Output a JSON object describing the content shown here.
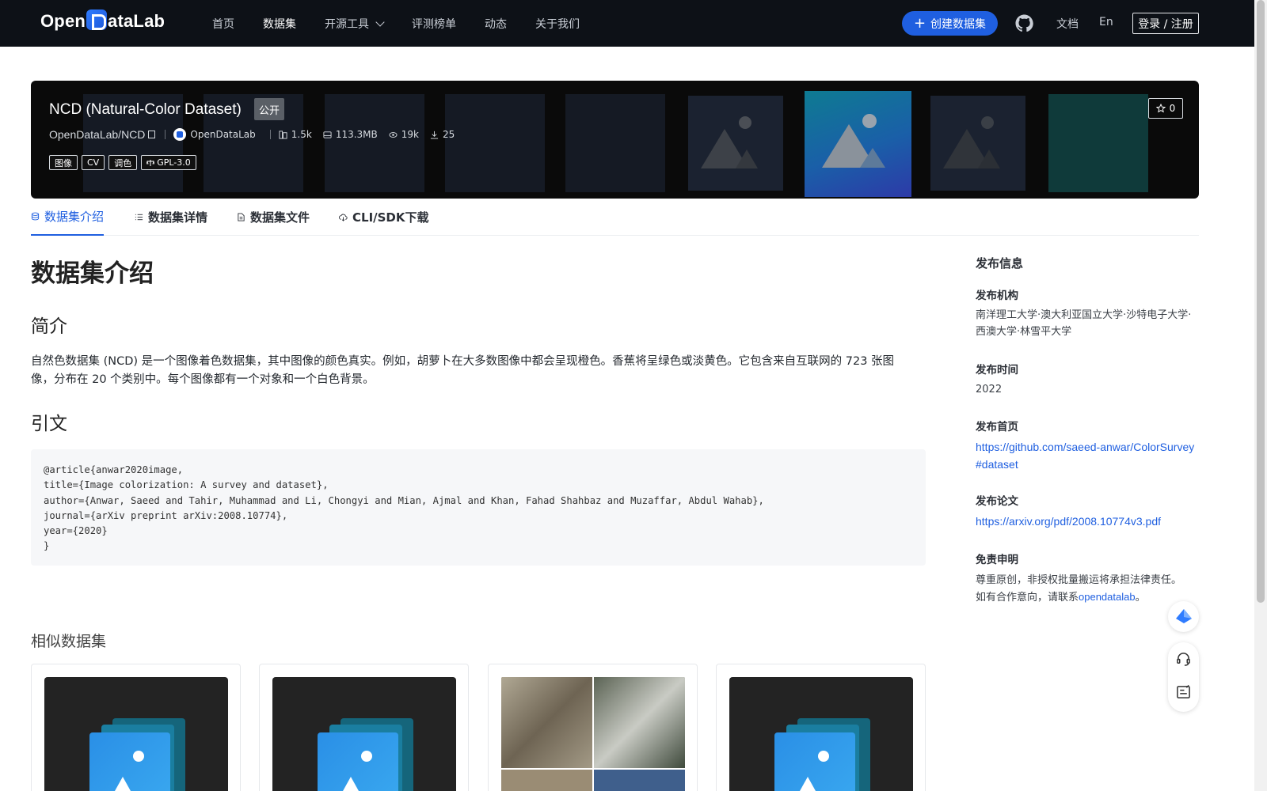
{
  "nav": {
    "logo": "OpenDataLab",
    "links": [
      {
        "label": "首页"
      },
      {
        "label": "数据集"
      },
      {
        "label": "开源工具"
      },
      {
        "label": "评测榜单"
      },
      {
        "label": "动态"
      },
      {
        "label": "关于我们"
      }
    ],
    "create_button": "创建数据集",
    "docs": "文档",
    "lang": "En",
    "login": "登录 / 注册"
  },
  "banner": {
    "title": "NCD (Natural-Color Dataset)",
    "visibility": "公开",
    "repo": "OpenDataLab/NCD",
    "org": "OpenDataLab",
    "stats": {
      "files": "1.5k",
      "size": "113.3MB",
      "views": "19k",
      "downloads": "25"
    },
    "tags": [
      "图像",
      "CV",
      "调色",
      "GPL-3.0"
    ],
    "stars": "0"
  },
  "tabs": [
    {
      "label": "数据集介绍"
    },
    {
      "label": "数据集详情"
    },
    {
      "label": "数据集文件"
    },
    {
      "label": "CLI/SDK下载"
    }
  ],
  "main": {
    "heading": "数据集介绍",
    "intro_heading": "简介",
    "intro_text": "自然色数据集 (NCD) 是一个图像着色数据集，其中图像的颜色真实。例如，胡萝卜在大多数图像中都会呈现橙色。香蕉将呈绿色或淡黄色。它包含来自互联网的 723 张图像，分布在 20 个类别中。每个图像都有一个对象和一个白色背景。",
    "citation_heading": "引文",
    "citation": "@article{anwar2020image,\ntitle={Image colorization: A survey and dataset},\nauthor={Anwar, Saeed and Tahir, Muhammad and Li, Chongyi and Mian, Ajmal and Khan, Fahad Shahbaz and Muzaffar, Abdul Wahab},\njournal={arXiv preprint arXiv:2008.10774},\nyear={2020}\n}",
    "similar_heading": "相似数据集"
  },
  "sidebar": {
    "heading": "发布信息",
    "org_label": "发布机构",
    "org_value": "南洋理工大学·澳大利亚国立大学·沙特电子大学·西澳大学·林雪平大学",
    "time_label": "发布时间",
    "time_value": "2022",
    "home_label": "发布首页",
    "home_value": "https://github.com/saeed-anwar/ColorSurvey#dataset",
    "paper_label": "发布论文",
    "paper_value": "https://arxiv.org/pdf/2008.10774v3.pdf",
    "disclaimer_label": "免责申明",
    "disclaimer_line1": "尊重原创，非授权批量搬运将承担法律责任。",
    "disclaimer_prefix": "如有合作意向，请联系",
    "disclaimer_link": "opendatalab",
    "disclaimer_suffix": "。"
  },
  "colors": {
    "nav_bg": "#0d1117",
    "accent": "#1f5fe0",
    "banner_bg": "#0a0a0a"
  }
}
